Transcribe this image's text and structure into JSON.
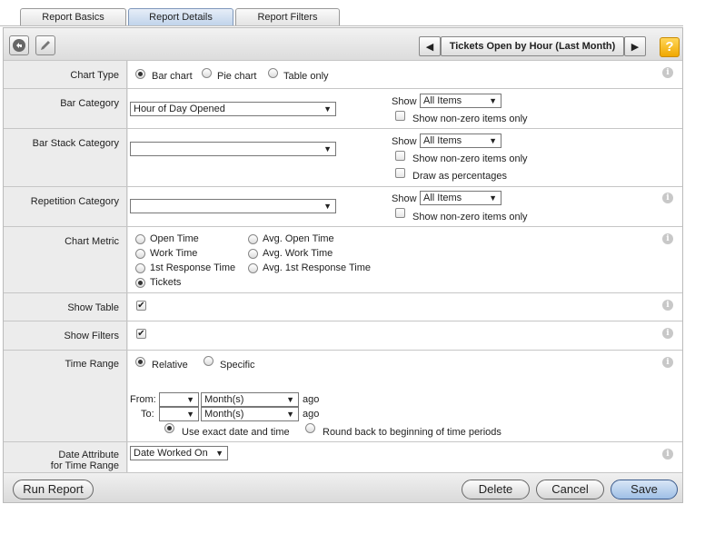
{
  "tabs": [
    "Report Basics",
    "Report Details",
    "Report Filters"
  ],
  "report_title": "Tickets Open by Hour (Last Month)",
  "help": "?",
  "info": "i",
  "chart_type": {
    "label": "Chart Type",
    "options": [
      "Bar chart",
      "Pie chart",
      "Table only"
    ],
    "selected": "Bar chart"
  },
  "bar_category": {
    "label": "Bar Category",
    "value": "Hour of Day Opened",
    "show_label": "Show",
    "show_value": "All Items",
    "nonzero": "Show non-zero items only"
  },
  "bar_stack": {
    "label": "Bar Stack Category",
    "value": "",
    "show_label": "Show",
    "show_value": "All Items",
    "nonzero": "Show non-zero items only",
    "percent": "Draw as percentages"
  },
  "repetition": {
    "label": "Repetition Category",
    "value": "",
    "show_label": "Show",
    "show_value": "All Items",
    "nonzero": "Show non-zero items only"
  },
  "chart_metric": {
    "label": "Chart Metric",
    "left": [
      "Open Time",
      "Work Time",
      "1st Response Time",
      "Tickets"
    ],
    "right": [
      "Avg. Open Time",
      "Avg. Work Time",
      "Avg. 1st Response Time"
    ],
    "selected": "Tickets"
  },
  "show_table": {
    "label": "Show Table",
    "checked": true
  },
  "show_filters": {
    "label": "Show Filters",
    "checked": true
  },
  "time_range": {
    "label": "Time Range",
    "relative": "Relative",
    "specific": "Specific",
    "selected": "Relative",
    "from": "From:",
    "to": "To:",
    "unit": "Month(s)",
    "ago": "ago",
    "exact": "Use exact date and time",
    "roundback": "Round back to beginning of time periods"
  },
  "date_attr": {
    "label_line1": "Date Attribute",
    "label_line2": "for Time Range",
    "value": "Date Worked On"
  },
  "footer": {
    "run": "Run Report",
    "delete": "Delete",
    "cancel": "Cancel",
    "save": "Save"
  }
}
